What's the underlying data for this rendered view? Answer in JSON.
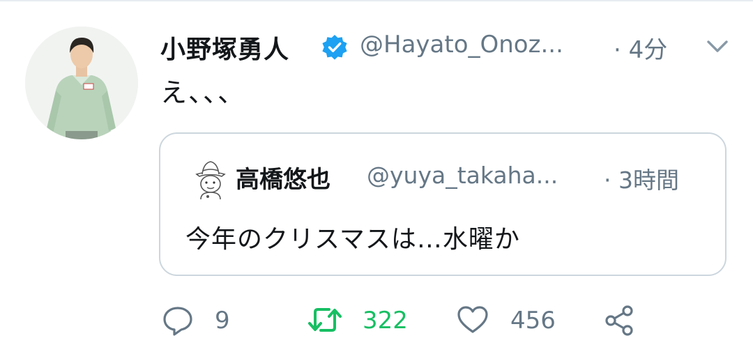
{
  "tweet": {
    "display_name": "小野塚勇人",
    "verified": true,
    "handle": "@Hayato_Onoz...",
    "timestamp": "· 4分",
    "text": "え、、、",
    "menu_icon": "chevron-down-icon"
  },
  "quoted_tweet": {
    "display_name": "高橋悠也",
    "handle": "@yuya_takaha...",
    "timestamp": "· 3時間",
    "text": "今年のクリスマスは…水曜か"
  },
  "actions": {
    "reply_count": "9",
    "retweet_count": "322",
    "like_count": "456",
    "retweet_color": "#17bf63",
    "icons": [
      "reply-icon",
      "retweet-icon",
      "like-icon",
      "share-icon"
    ]
  },
  "colors": {
    "text": "#14171a",
    "secondary": "#657786",
    "verified": "#1da1f2",
    "border": "#ccd6dd"
  }
}
